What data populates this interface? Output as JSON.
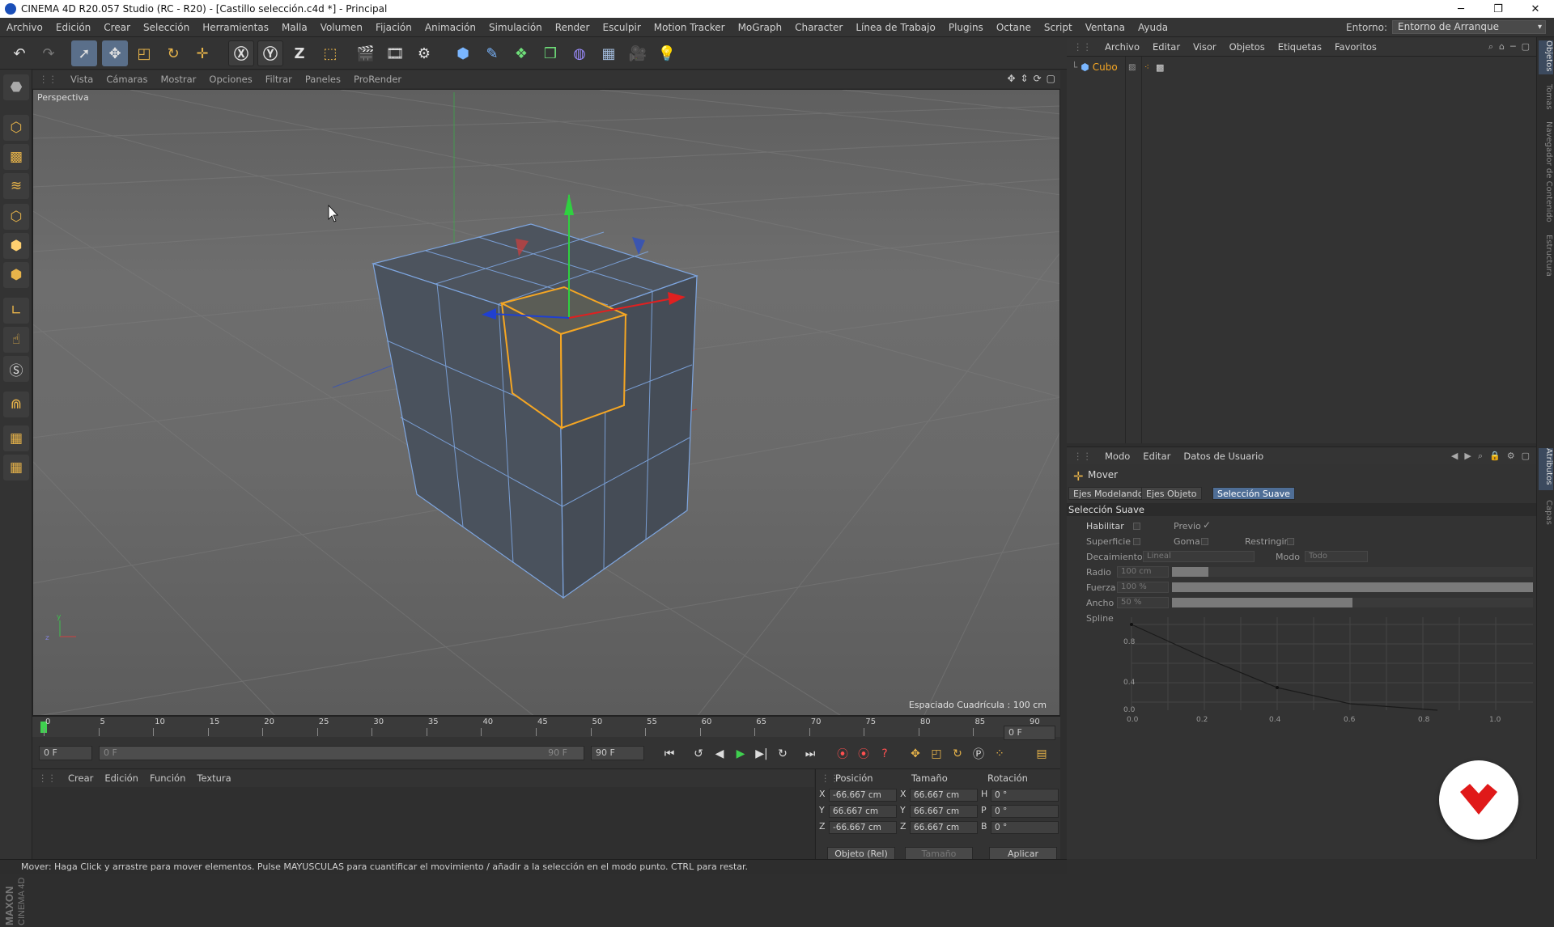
{
  "window": {
    "title": "CINEMA 4D R20.057 Studio (RC - R20) - [Castillo selección.c4d *] - Principal",
    "minimize": "─",
    "maximize": "❐",
    "close": "✕"
  },
  "menubar": {
    "items": [
      "Archivo",
      "Edición",
      "Crear",
      "Selección",
      "Herramientas",
      "Malla",
      "Volumen",
      "Fijación",
      "Animación",
      "Simulación",
      "Render",
      "Esculpir",
      "Motion Tracker",
      "MoGraph",
      "Character",
      "Línea de Trabajo",
      "Plugins",
      "Octane",
      "Script",
      "Ventana",
      "Ayuda"
    ],
    "env_label": "Entorno:",
    "env_value": "Entorno de Arranque"
  },
  "viewport": {
    "menu": [
      "Vista",
      "Cámaras",
      "Mostrar",
      "Opciones",
      "Filtrar",
      "Paneles",
      "ProRender"
    ],
    "label": "Perspectiva",
    "grid_spacing": "Espaciado Cuadrícula : 100 cm",
    "nav_icons": [
      "move-view-icon",
      "zoom-view-icon",
      "rotate-view-icon",
      "toggle-view-icon"
    ]
  },
  "timeline": {
    "ticks": [
      "0",
      "5",
      "10",
      "15",
      "20",
      "25",
      "30",
      "35",
      "40",
      "45",
      "50",
      "55",
      "60",
      "65",
      "70",
      "75",
      "80",
      "85",
      "90"
    ],
    "current_frame": "0 F"
  },
  "transport": {
    "start": "0 F",
    "range_start": "0 F",
    "range_end": "90 F",
    "end": "90 F"
  },
  "material_manager": {
    "menu": [
      "Crear",
      "Edición",
      "Función",
      "Textura"
    ]
  },
  "coordinates": {
    "headers": {
      "position": "Posición",
      "size": "Tamaño",
      "rotation": "Rotación"
    },
    "rows": [
      {
        "axis": "X",
        "pos": "-66.667 cm",
        "size_axis": "X",
        "size": "66.667 cm",
        "rot_axis": "H",
        "rot": "0 °"
      },
      {
        "axis": "Y",
        "pos": "66.667 cm",
        "size_axis": "Y",
        "size": "66.667 cm",
        "rot_axis": "P",
        "rot": "0 °"
      },
      {
        "axis": "Z",
        "pos": "-66.667 cm",
        "size_axis": "Z",
        "size": "66.667 cm",
        "rot_axis": "B",
        "rot": "0 °"
      }
    ],
    "mode": "Objeto (Rel)",
    "size_mode": "Tamaño",
    "apply": "Aplicar"
  },
  "status": "Mover: Haga Click y arrastre para mover elementos. Pulse MAYUSCULAS para cuantificar el movimiento / añadir a la selección en el modo punto. CTRL para restar.",
  "object_manager": {
    "menu": [
      "Archivo",
      "Editar",
      "Visor",
      "Objetos",
      "Etiquetas",
      "Favoritos"
    ],
    "object_name": "Cubo"
  },
  "attributes": {
    "menu": [
      "Modo",
      "Editar",
      "Datos de Usuario"
    ],
    "tool": "Mover",
    "tabs": [
      "Ejes Modelando",
      "Ejes Objeto",
      "Selección Suave"
    ],
    "section": "Selección Suave",
    "habilitar": "Habilitar",
    "previo": "Previo",
    "previo_check": "✓",
    "superficie": "Superficie",
    "goma": "Goma",
    "restringir": "Restringir",
    "decaimiento": "Decaimiento",
    "decaimiento_val": "Lineal",
    "modo": "Modo",
    "modo_val": "Todo",
    "radio": "Radio",
    "radio_val": "100 cm",
    "radio_frac": 0.1,
    "fuerza": "Fuerza",
    "fuerza_val": "100 %",
    "fuerza_frac": 1.0,
    "ancho": "Ancho",
    "ancho_val": "50 %",
    "ancho_frac": 0.5,
    "spline": "Spline",
    "spline_y_ticks": [
      "0.8",
      "0.4",
      "0.0"
    ],
    "spline_x_ticks": [
      "0.0",
      "0.2",
      "0.4",
      "0.6",
      "0.8",
      "1.0"
    ]
  },
  "right_tabs": [
    "Objetos",
    "Tomas",
    "Navegador de Contenido",
    "Estructura",
    "Atributos",
    "Capas"
  ],
  "colors": {
    "accent_blue": "#4f6e96",
    "selection_orange": "#f5a623",
    "badge_red": "#e01919"
  }
}
